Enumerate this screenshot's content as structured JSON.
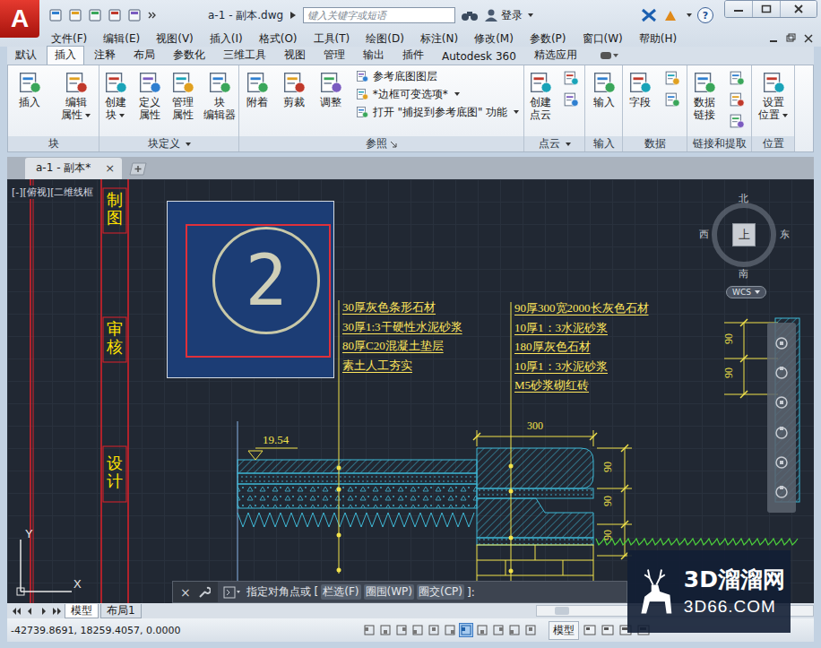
{
  "app": {
    "logo": "A",
    "title": "a-1 - 副本.dwg",
    "search_placeholder": "键入关键字或短语",
    "login": "登录",
    "help": "?"
  },
  "menu": [
    "文件(F)",
    "编辑(E)",
    "视图(V)",
    "插入(I)",
    "格式(O)",
    "工具(T)",
    "绘图(D)",
    "标注(N)",
    "修改(M)",
    "参数(P)",
    "窗口(W)",
    "帮助(H)"
  ],
  "ribbon_tabs": [
    {
      "label": "默认",
      "selected": false
    },
    {
      "label": "插入",
      "selected": true
    },
    {
      "label": "注释",
      "selected": false
    },
    {
      "label": "布局",
      "selected": false
    },
    {
      "label": "参数化",
      "selected": false
    },
    {
      "label": "三维工具",
      "selected": false
    },
    {
      "label": "视图",
      "selected": false
    },
    {
      "label": "管理",
      "selected": false
    },
    {
      "label": "输出",
      "selected": false
    },
    {
      "label": "插件",
      "selected": false
    },
    {
      "label": "Autodesk 360",
      "selected": false
    },
    {
      "label": "精选应用",
      "selected": false
    }
  ],
  "ribbon_groups": [
    {
      "title": "块",
      "menu": false,
      "launcher": false,
      "tools": [
        {
          "kind": "large",
          "lines": [
            "插入"
          ],
          "dropdown": false
        },
        {
          "kind": "large",
          "lines": [
            "编辑",
            "属性"
          ],
          "dropdown": true
        }
      ]
    },
    {
      "title": "块定义",
      "menu": true,
      "launcher": false,
      "tools": [
        {
          "kind": "large",
          "lines": [
            "创建",
            "块"
          ],
          "dropdown": true
        },
        {
          "kind": "large",
          "lines": [
            "定义",
            "属性"
          ],
          "dropdown": false
        },
        {
          "kind": "large",
          "lines": [
            "管理",
            "属性"
          ],
          "dropdown": false
        },
        {
          "kind": "large",
          "lines": [
            "块",
            "编辑器"
          ],
          "dropdown": false
        }
      ]
    },
    {
      "title": "参照",
      "menu": false,
      "launcher": true,
      "tools": [
        {
          "kind": "large",
          "lines": [
            "附着"
          ],
          "dropdown": false
        },
        {
          "kind": "large",
          "lines": [
            "剪裁"
          ],
          "dropdown": false
        },
        {
          "kind": "large",
          "lines": [
            "调整"
          ],
          "dropdown": false
        },
        {
          "kind": "small",
          "lines": [
            "参考底图图层"
          ],
          "dropdown": false
        },
        {
          "kind": "small",
          "lines": [
            "*边框可变选项*"
          ],
          "dropdown": true
        },
        {
          "kind": "small",
          "lines": [
            "打开 \"捕捉到参考底图\" 功能"
          ],
          "dropdown": true
        }
      ]
    },
    {
      "title": "点云",
      "menu": true,
      "launcher": false,
      "tools": [
        {
          "kind": "large",
          "lines": [
            "创建",
            "点云"
          ],
          "dropdown": false
        },
        {
          "kind": "icon"
        },
        {
          "kind": "icon"
        }
      ]
    },
    {
      "title": "输入",
      "menu": false,
      "launcher": false,
      "tools": [
        {
          "kind": "large",
          "lines": [
            "输入"
          ],
          "dropdown": false
        }
      ]
    },
    {
      "title": "数据",
      "menu": false,
      "launcher": false,
      "tools": [
        {
          "kind": "large",
          "lines": [
            "字段"
          ],
          "dropdown": false
        },
        {
          "kind": "icon"
        },
        {
          "kind": "icon"
        }
      ]
    },
    {
      "title": "链接和提取",
      "menu": false,
      "launcher": false,
      "tools": [
        {
          "kind": "large",
          "lines": [
            "数据",
            "链接"
          ],
          "dropdown": false
        },
        {
          "kind": "icon"
        },
        {
          "kind": "icon"
        },
        {
          "kind": "icon"
        }
      ]
    },
    {
      "title": "位置",
      "menu": false,
      "launcher": false,
      "tools": [
        {
          "kind": "large",
          "lines": [
            "设置",
            "位置"
          ],
          "dropdown": true
        }
      ]
    }
  ],
  "doc_tabs": [
    {
      "label": "a-1 - 副本*",
      "selected": true,
      "close": "×"
    }
  ],
  "viewport_label": "[-][俯视][二维线框",
  "title_block": [
    "制图",
    "审核",
    "设计"
  ],
  "detail_marker": "2",
  "notes_left": [
    "30厚灰色条形石材",
    "30厚1:3干硬性水泥砂浆",
    "80厚C20混凝土垫层",
    "素土人工夯实"
  ],
  "notes_right": [
    "90厚300宽2000长灰色石材",
    "10厚1：3水泥砂浆",
    "180厚灰色石材",
    "10厚1：3水泥砂浆",
    "M5砂浆砌红砖"
  ],
  "dimensions": {
    "elevation": "19.54",
    "width": "300",
    "right_heights": [
      "90",
      "90",
      "90"
    ],
    "far_right_heights": [
      "90",
      "90"
    ]
  },
  "viewcube": {
    "north": "北",
    "south": "南",
    "east": "东",
    "west": "西",
    "face": "上",
    "ucs": "WCS"
  },
  "ucs_axes": {
    "x": "X",
    "y": "Y"
  },
  "command": {
    "close": "×",
    "prompt": "指定对角点或 [",
    "options": [
      "栏选(F)",
      "圈围(WP)",
      "圈交(CP)"
    ],
    "suffix": "]:"
  },
  "layout_tabs": [
    {
      "label": "模型",
      "selected": true
    },
    {
      "label": "布局1",
      "selected": false
    }
  ],
  "status": {
    "coords": "-42739.8691, 18259.4057, 0.0000",
    "toggles": [
      {
        "on": false
      },
      {
        "on": false
      },
      {
        "on": false
      },
      {
        "on": false
      },
      {
        "on": false
      },
      {
        "on": false
      },
      {
        "on": true
      },
      {
        "on": false
      },
      {
        "on": false
      },
      {
        "on": false
      },
      {
        "on": false
      }
    ],
    "space": "模型"
  },
  "watermark": {
    "name": "3D溜溜网",
    "url": "3D66.COM"
  }
}
